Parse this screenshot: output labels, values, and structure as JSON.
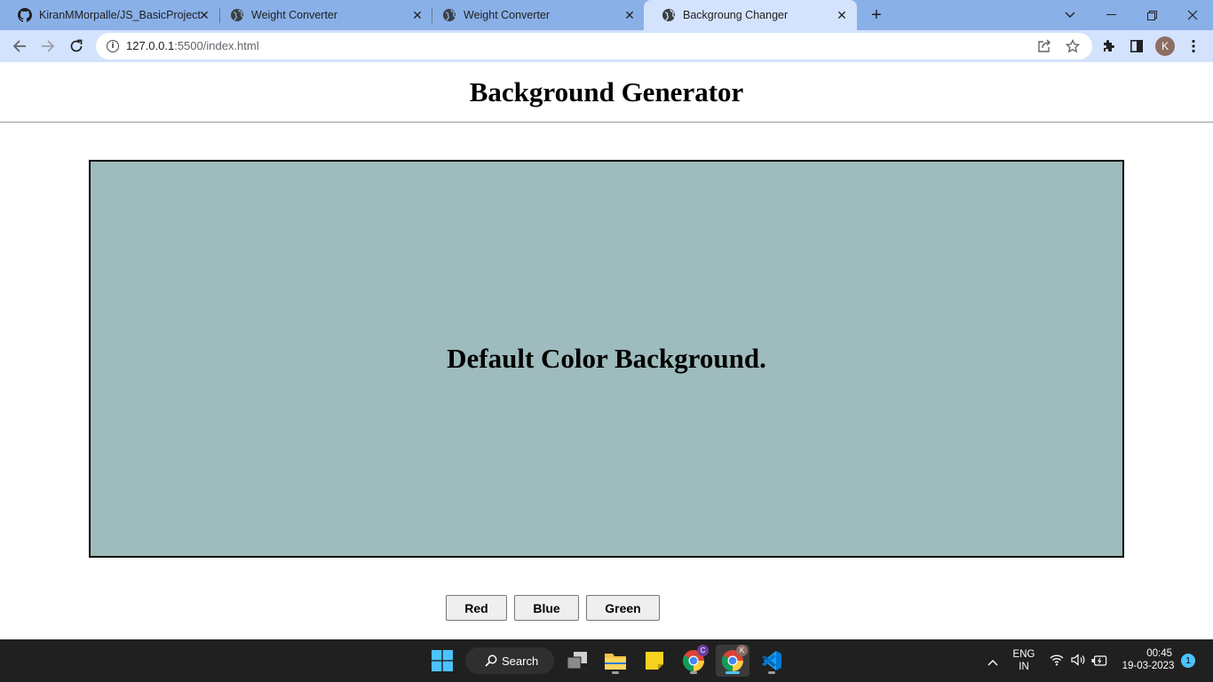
{
  "browser": {
    "tabs": [
      {
        "title": "KiranMMorpalle/JS_BasicProject",
        "icon": "github-icon",
        "active": false
      },
      {
        "title": "Weight Converter",
        "icon": "globe-icon",
        "active": false
      },
      {
        "title": "Weight Converter",
        "icon": "globe-icon",
        "active": false
      },
      {
        "title": "Backgroung Changer",
        "icon": "globe-icon",
        "active": true
      }
    ],
    "url_host": "127.0.0.1",
    "url_rest": ":5500/index.html",
    "profile_initial": "K"
  },
  "page": {
    "title": "Background Generator",
    "box_text": "Default Color Background.",
    "box_color": "#9ebbbd",
    "buttons": {
      "red": "Red",
      "blue": "Blue",
      "green": "Green"
    }
  },
  "taskbar": {
    "search_label": "Search",
    "chrome_badge_c": "C",
    "chrome_badge_k": "K",
    "lang_line1": "ENG",
    "lang_line2": "IN",
    "time": "00:45",
    "date": "19-03-2023",
    "notification_count": "1"
  }
}
